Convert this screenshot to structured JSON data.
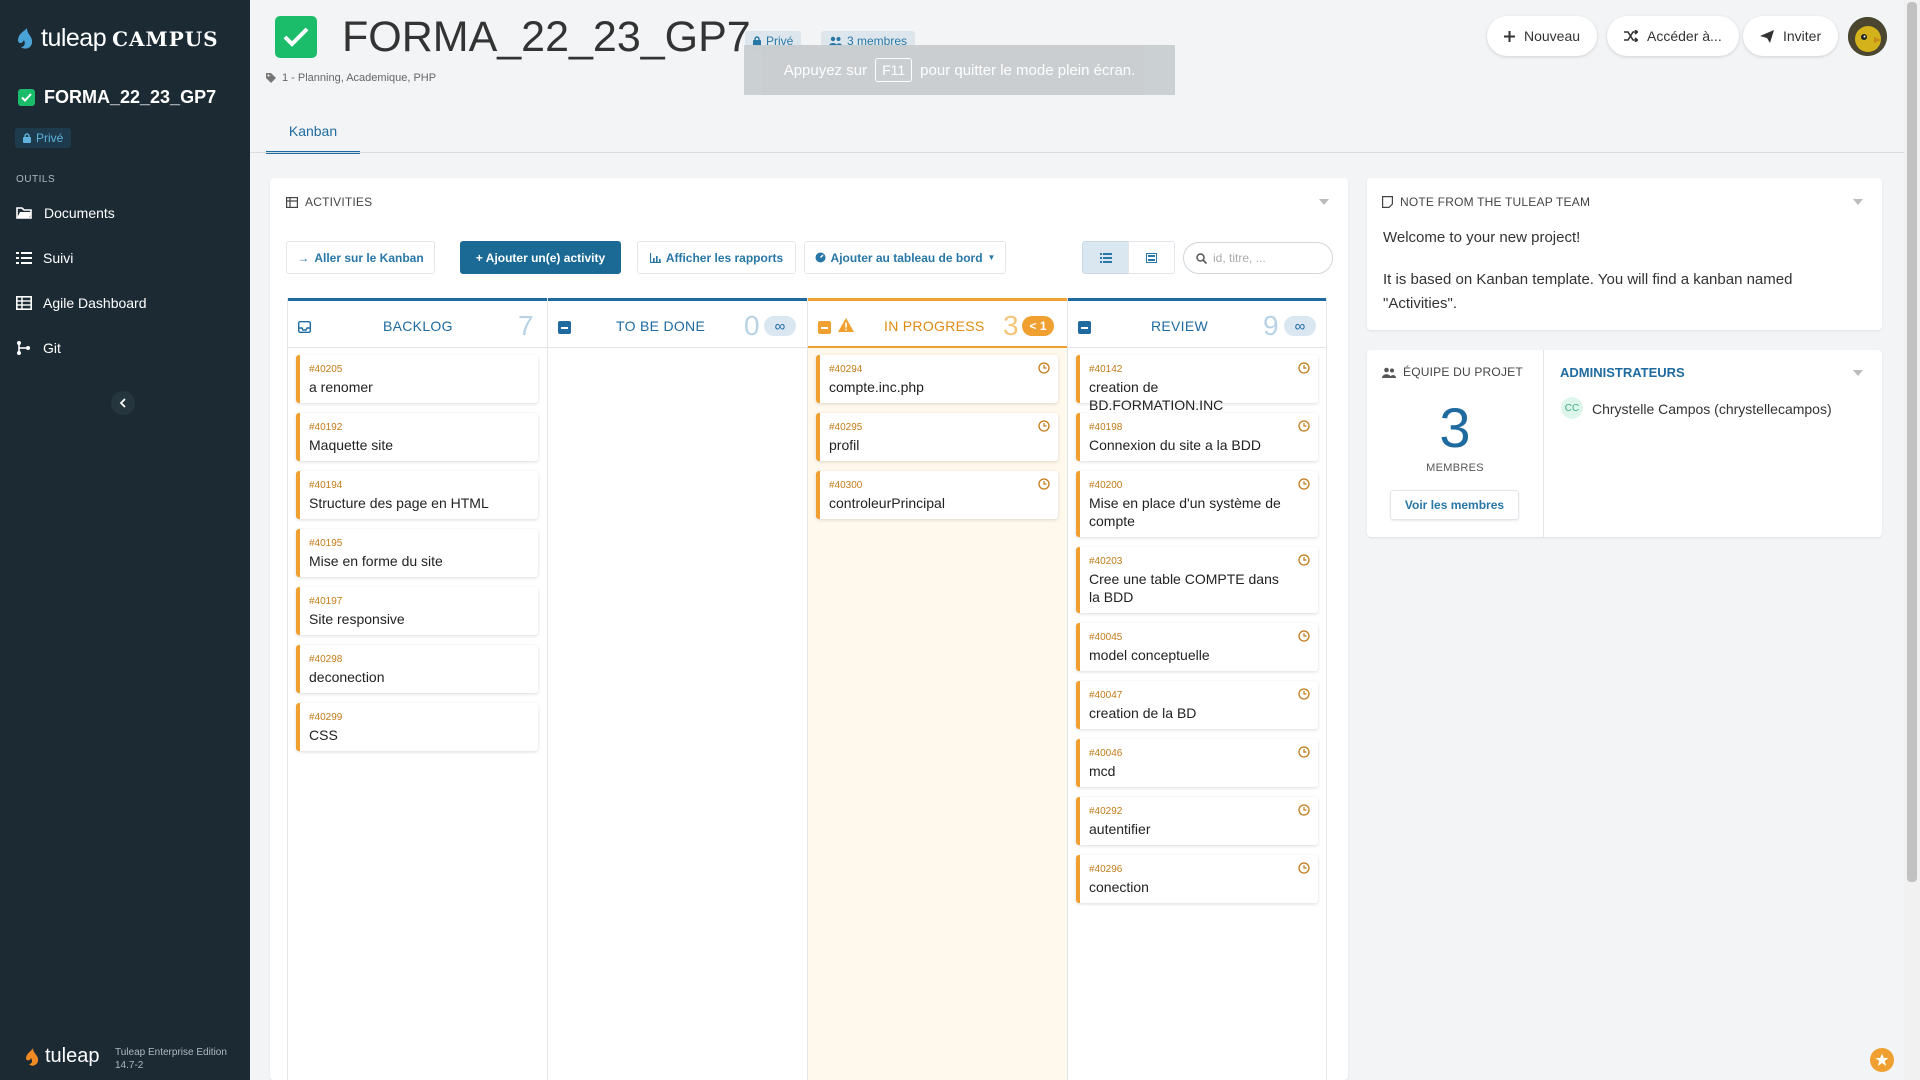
{
  "sidebar": {
    "logo_text": "tuleap",
    "logo_suffix": "CAMPUS",
    "project_name": "FORMA_22_23_GP7",
    "privacy": "Privé",
    "tools_heading": "OUTILS",
    "items": [
      {
        "label": "Documents",
        "icon": "folder-icon"
      },
      {
        "label": "Suivi",
        "icon": "list-icon"
      },
      {
        "label": "Agile Dashboard",
        "icon": "table-icon"
      },
      {
        "label": "Git",
        "icon": "git-icon"
      }
    ],
    "footer_logo": "tuleap",
    "edition": "Tuleap Enterprise Edition",
    "version": "14.7-2"
  },
  "header": {
    "title": "FORMA_22_23_GP7",
    "privacy": "Privé",
    "members": "3 membres",
    "tags": "1 - Planning, Academique, PHP",
    "fullscreen_msg_before": "Appuyez sur",
    "fullscreen_key": "F11",
    "fullscreen_msg_after": "pour quitter le mode plein écran.",
    "buttons": {
      "new": "Nouveau",
      "access": "Accéder à...",
      "invite": "Inviter"
    }
  },
  "tabs": [
    {
      "label": "Kanban"
    }
  ],
  "activities": {
    "title": "ACTIVITIES",
    "go_kanban": "Aller sur le Kanban",
    "add": "+ Ajouter un(e) activity",
    "reports": "Afficher les rapports",
    "dashboard": "Ajouter au tableau de bord",
    "search_placeholder": "id, titre, ..."
  },
  "columns": [
    {
      "name": "BACKLOG",
      "count": "7",
      "wip": "",
      "cards": [
        {
          "id": "#40205",
          "title": "a renomer"
        },
        {
          "id": "#40192",
          "title": "Maquette site"
        },
        {
          "id": "#40194",
          "title": "Structure des page en HTML"
        },
        {
          "id": "#40195",
          "title": "Mise en forme du site"
        },
        {
          "id": "#40197",
          "title": "Site responsive"
        },
        {
          "id": "#40298",
          "title": "deconection"
        },
        {
          "id": "#40299",
          "title": "CSS"
        }
      ]
    },
    {
      "name": "TO BE DONE",
      "count": "0",
      "wip": "∞",
      "cards": []
    },
    {
      "name": "IN PROGRESS",
      "count": "3",
      "wip": "< 1",
      "cards": [
        {
          "id": "#40294",
          "title": "compte.inc.php"
        },
        {
          "id": "#40295",
          "title": "profil"
        },
        {
          "id": "#40300",
          "title": "controleurPrincipal"
        }
      ]
    },
    {
      "name": "REVIEW",
      "count": "9",
      "wip": "∞",
      "cards": [
        {
          "id": "#40142",
          "title": "creation de BD.FORMATION.INC"
        },
        {
          "id": "#40198",
          "title": "Connexion du site a la BDD"
        },
        {
          "id": "#40200",
          "title": "Mise en place d'un système de compte"
        },
        {
          "id": "#40203",
          "title": "Cree une table COMPTE dans la BDD"
        },
        {
          "id": "#40045",
          "title": "model conceptuelle"
        },
        {
          "id": "#40047",
          "title": "creation de la BD"
        },
        {
          "id": "#40046",
          "title": "mcd"
        },
        {
          "id": "#40292",
          "title": "autentifier"
        },
        {
          "id": "#40296",
          "title": "conection"
        }
      ]
    }
  ],
  "note": {
    "title": "NOTE FROM THE TULEAP TEAM",
    "line1": "Welcome to your new project!",
    "line2": "It is based on Kanban template. You will find a kanban named \"Activities\"."
  },
  "team": {
    "title": "ÉQUIPE DU PROJET",
    "count": "3",
    "members_label": "MEMBRES",
    "see_members": "Voir les membres",
    "admins_title": "ADMINISTRATEURS",
    "admin_initials": "CC",
    "admin_name": "Chrystelle Campos (chrystellecampos)"
  },
  "colors": {
    "accent": "#1f6ba0",
    "sidebar": "#1c2a34",
    "success": "#1bbc6a",
    "warning": "#f0a030"
  }
}
